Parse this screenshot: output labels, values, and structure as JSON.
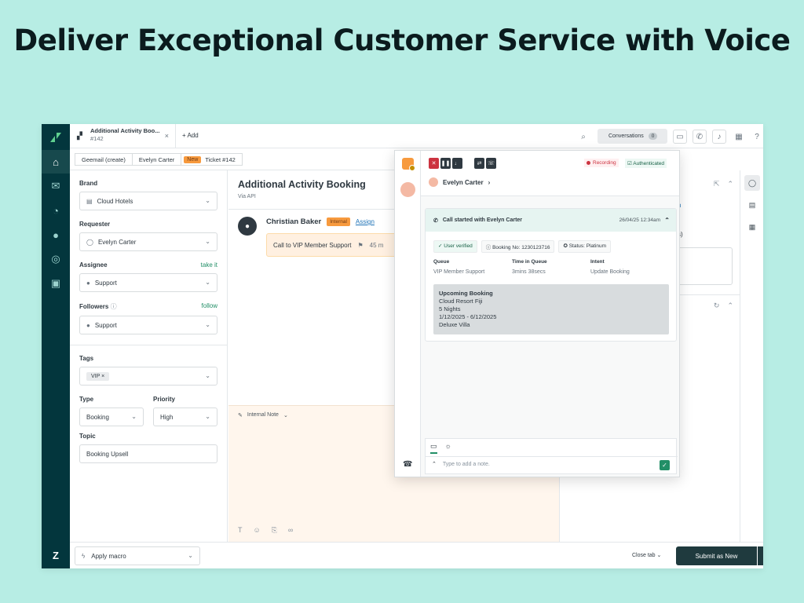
{
  "headline": "Deliver Exceptional Customer Service with Voice",
  "topbar": {
    "tab_title": "Additional Activity Boo...",
    "tab_subtitle": "#142",
    "add_label": "Add",
    "conversations_label": "Conversations",
    "conversations_count": "0"
  },
  "breadcrumb": {
    "item1": "Geemail (create)",
    "item2": "Evelyn Carter",
    "status": "New",
    "ticket": "Ticket #142"
  },
  "properties": {
    "brand_label": "Brand",
    "brand_value": "Cloud Hotels",
    "requester_label": "Requester",
    "requester_value": "Evelyn Carter",
    "assignee_label": "Assignee",
    "assignee_link": "take it",
    "assignee_value": "Support",
    "followers_label": "Followers",
    "followers_link": "follow",
    "followers_value": "Support",
    "tags_label": "Tags",
    "tag_vip": "VIP",
    "type_label": "Type",
    "type_value": "Booking",
    "priority_label": "Priority",
    "priority_value": "High",
    "topic_label": "Topic",
    "topic_value": "Booking Upsell"
  },
  "conversation": {
    "title": "Additional Activity Booking",
    "via": "Via API",
    "author": "Christian Baker",
    "internal_badge": "Internal",
    "assign_link": "Assign",
    "call_text": "Call to VIP Member Support",
    "call_duration": "45 m",
    "composer_mode": "Internal Note"
  },
  "voice": {
    "recording": "Recording",
    "authenticated": "Authenticated",
    "caller_name": "Evelyn Carter",
    "call_started": "Call started with Evelyn Carter",
    "call_time": "26/04/25 12:34am",
    "tag_verified": "User verified",
    "tag_booking": "Booking No: 1230123716",
    "tag_status": "Status: Platinum",
    "queue_label": "Queue",
    "queue_value": "VIP Member Support",
    "time_label": "Time in Queue",
    "time_value": "3mins 38secs",
    "intent_label": "Intent",
    "intent_value": "Update Booking",
    "booking_title": "Upcoming Booking",
    "booking_line1": "Cloud Resort Fiji",
    "booking_line2": "5 Nights",
    "booking_line3": "1/12/2025 - 6/12/2025",
    "booking_line4": "Deluxe Villa",
    "note_placeholder": "Type to add a note."
  },
  "bottom": {
    "macro_label": "Apply macro",
    "close_tab": "Close tab",
    "submit_label": "Submit as New"
  },
  "right_panel": {
    "snippet1": "n",
    "snippet2": "s)"
  }
}
